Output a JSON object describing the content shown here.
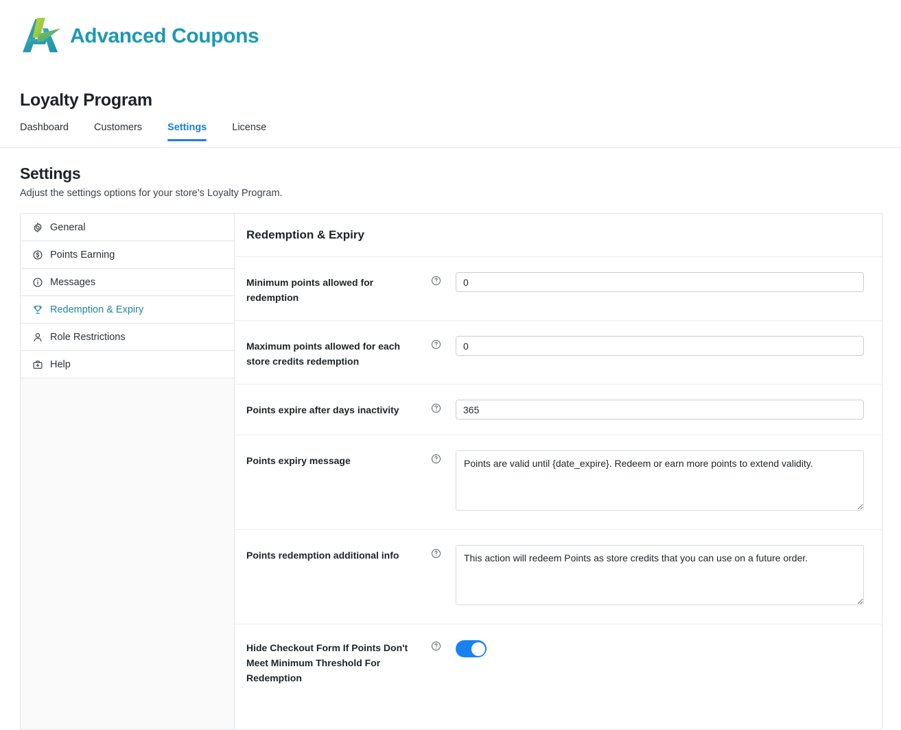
{
  "brand": {
    "name": "Advanced Coupons",
    "logo_icon": "advanced-coupons-a-logo",
    "color": "#1c9ab0"
  },
  "header": {
    "title": "Loyalty Program",
    "tabs": [
      {
        "label": "Dashboard",
        "active": false
      },
      {
        "label": "Customers",
        "active": false
      },
      {
        "label": "Settings",
        "active": true
      },
      {
        "label": "License",
        "active": false
      }
    ],
    "active_tab_color": "#1a7fe8"
  },
  "intro": {
    "title": "Settings",
    "subtitle": "Adjust the settings options for your store’s Loyalty Program."
  },
  "sidebar": {
    "active_color": "#22859c",
    "items": [
      {
        "label": "General",
        "icon": "gear-icon",
        "active": false
      },
      {
        "label": "Points Earning",
        "icon": "dollar-circle-icon",
        "active": false
      },
      {
        "label": "Messages",
        "icon": "info-circle-icon",
        "active": false
      },
      {
        "label": "Redemption & Expiry",
        "icon": "trophy-icon",
        "active": true
      },
      {
        "label": "Role Restrictions",
        "icon": "user-icon",
        "active": false
      },
      {
        "label": "Help",
        "icon": "first-aid-kit-icon",
        "active": false
      }
    ]
  },
  "panel": {
    "heading": "Redemption & Expiry",
    "help_icon": "question-circle-icon",
    "fields": [
      {
        "label": "Minimum points allowed for redemption",
        "type": "text",
        "value": "0"
      },
      {
        "label": "Maximum points allowed for each store credits redemption",
        "type": "text",
        "value": "0"
      },
      {
        "label": "Points expire after days inactivity",
        "type": "text",
        "value": "365"
      },
      {
        "label": "Points expiry message",
        "type": "textarea",
        "value": "Points are valid until {date_expire}. Redeem or earn more points to extend validity."
      },
      {
        "label": "Points redemption additional info",
        "type": "textarea",
        "value": "This action will redeem Points as store credits that you can use on a future order."
      },
      {
        "label": "Hide Checkout Form If Points Don't Meet Minimum Threshold For Redemption",
        "type": "toggle",
        "value": "on",
        "toggle_color": "#1a82f0"
      }
    ]
  }
}
